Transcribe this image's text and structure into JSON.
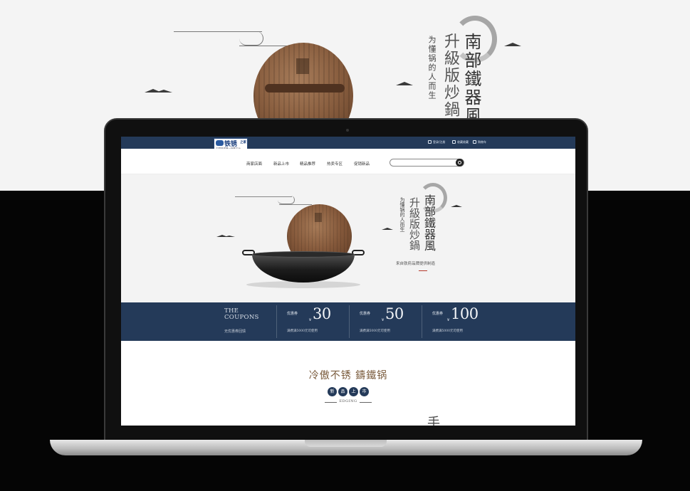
{
  "showcase": {
    "big_vertical_main": "南部鐵器風",
    "big_vertical_sub1": "升級版炒鍋",
    "big_vertical_sub2": "为懂锅的人而生"
  },
  "site": {
    "logo_text": "铁锈",
    "logo_badge": "之家",
    "logo_sub": "中国铁锈第一销售平台",
    "top_links": [
      "登录/注册",
      "收藏收藏",
      "购物车"
    ],
    "nav": [
      "商家店面",
      "新品上市",
      "精品推荐",
      "热卖专区",
      "促销新品"
    ],
    "search_placeholder": "",
    "colors": {
      "navy": "#243a59",
      "bronze": "#7a5b3c",
      "accent_red": "#b53a2c"
    }
  },
  "hero": {
    "title_right": "南部鐵器風",
    "title_mid": "升級版炒鍋",
    "title_left": "为懂锅的人而生",
    "description": "来自铁府品牌提供制造"
  },
  "coupons": {
    "title": "THE\nCOUPONS",
    "subtitle": "无优惠券回馈",
    "items": [
      {
        "label": "优惠券",
        "currency": "¥",
        "amount": "30",
        "note": "满费满5000元可使用"
      },
      {
        "label": "优惠券",
        "currency": "¥",
        "amount": "50",
        "note": "满费满5000元可使用"
      },
      {
        "label": "优惠券",
        "currency": "¥",
        "amount": "100",
        "note": "满费满5000元可使用"
      }
    ]
  },
  "section": {
    "title": "冷傲不锈 鑄鐵锅",
    "badges": [
      "新",
      "品",
      "上",
      "市"
    ],
    "edging": "EDGING",
    "peek_char": "手"
  }
}
